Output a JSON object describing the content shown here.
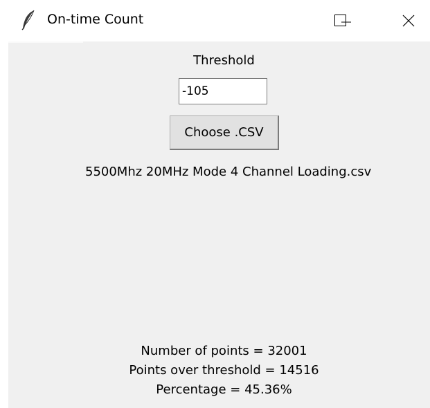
{
  "window": {
    "title": "On-time Count",
    "icon": "feather-icon",
    "controls": [
      "minimize-icon",
      "maximize-icon",
      "close-icon"
    ]
  },
  "form": {
    "threshold_label": "Threshold",
    "threshold_value": "-105",
    "choose_button_label": "Choose .CSV",
    "selected_file": "5500Mhz 20MHz Mode 4 Channel Loading.csv"
  },
  "results": {
    "num_points": "Number of points = 32001",
    "points_over": "Points over threshold = 14516",
    "percentage": "Percentage = 45.36%"
  },
  "colors": {
    "client_background": "#f0f0f0",
    "titlebar_background": "#ffffff",
    "button_background": "#e1e1e1"
  }
}
